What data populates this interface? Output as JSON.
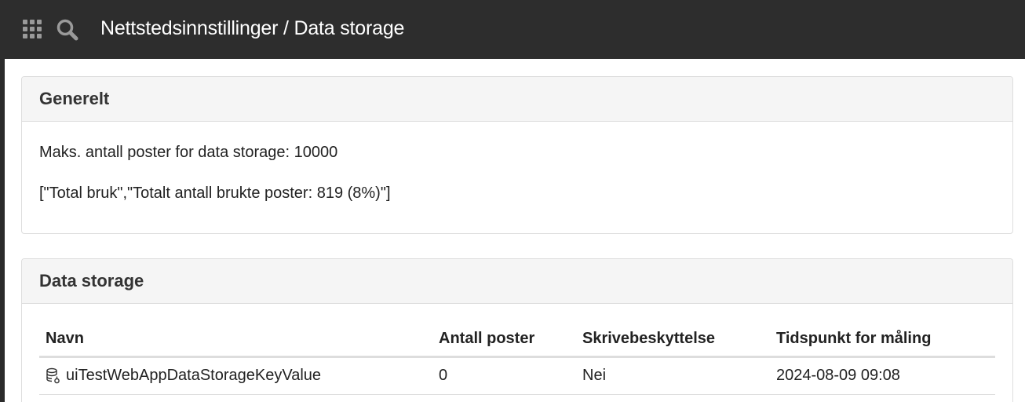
{
  "header": {
    "apps_icon": "grid-icon",
    "search_icon": "search-icon",
    "title": "Nettstedsinnstillinger / Data storage"
  },
  "general": {
    "heading": "Generelt",
    "max_records": "Maks. antall poster for data storage: 10000",
    "usage": "[\"Total bruk\",\"Totalt antall brukte poster: 819 (8%)\"]"
  },
  "storage": {
    "heading": "Data storage",
    "columns": [
      "Navn",
      "Antall poster",
      "Skrivebeskyttelse",
      "Tidspunkt for måling"
    ],
    "rows": [
      {
        "icon": "database-key-icon",
        "name": "uiTestWebAppDataStorageKeyValue",
        "count": "0",
        "write_protection": "Nei",
        "measured_at": "2024-08-09 09:08"
      }
    ]
  }
}
